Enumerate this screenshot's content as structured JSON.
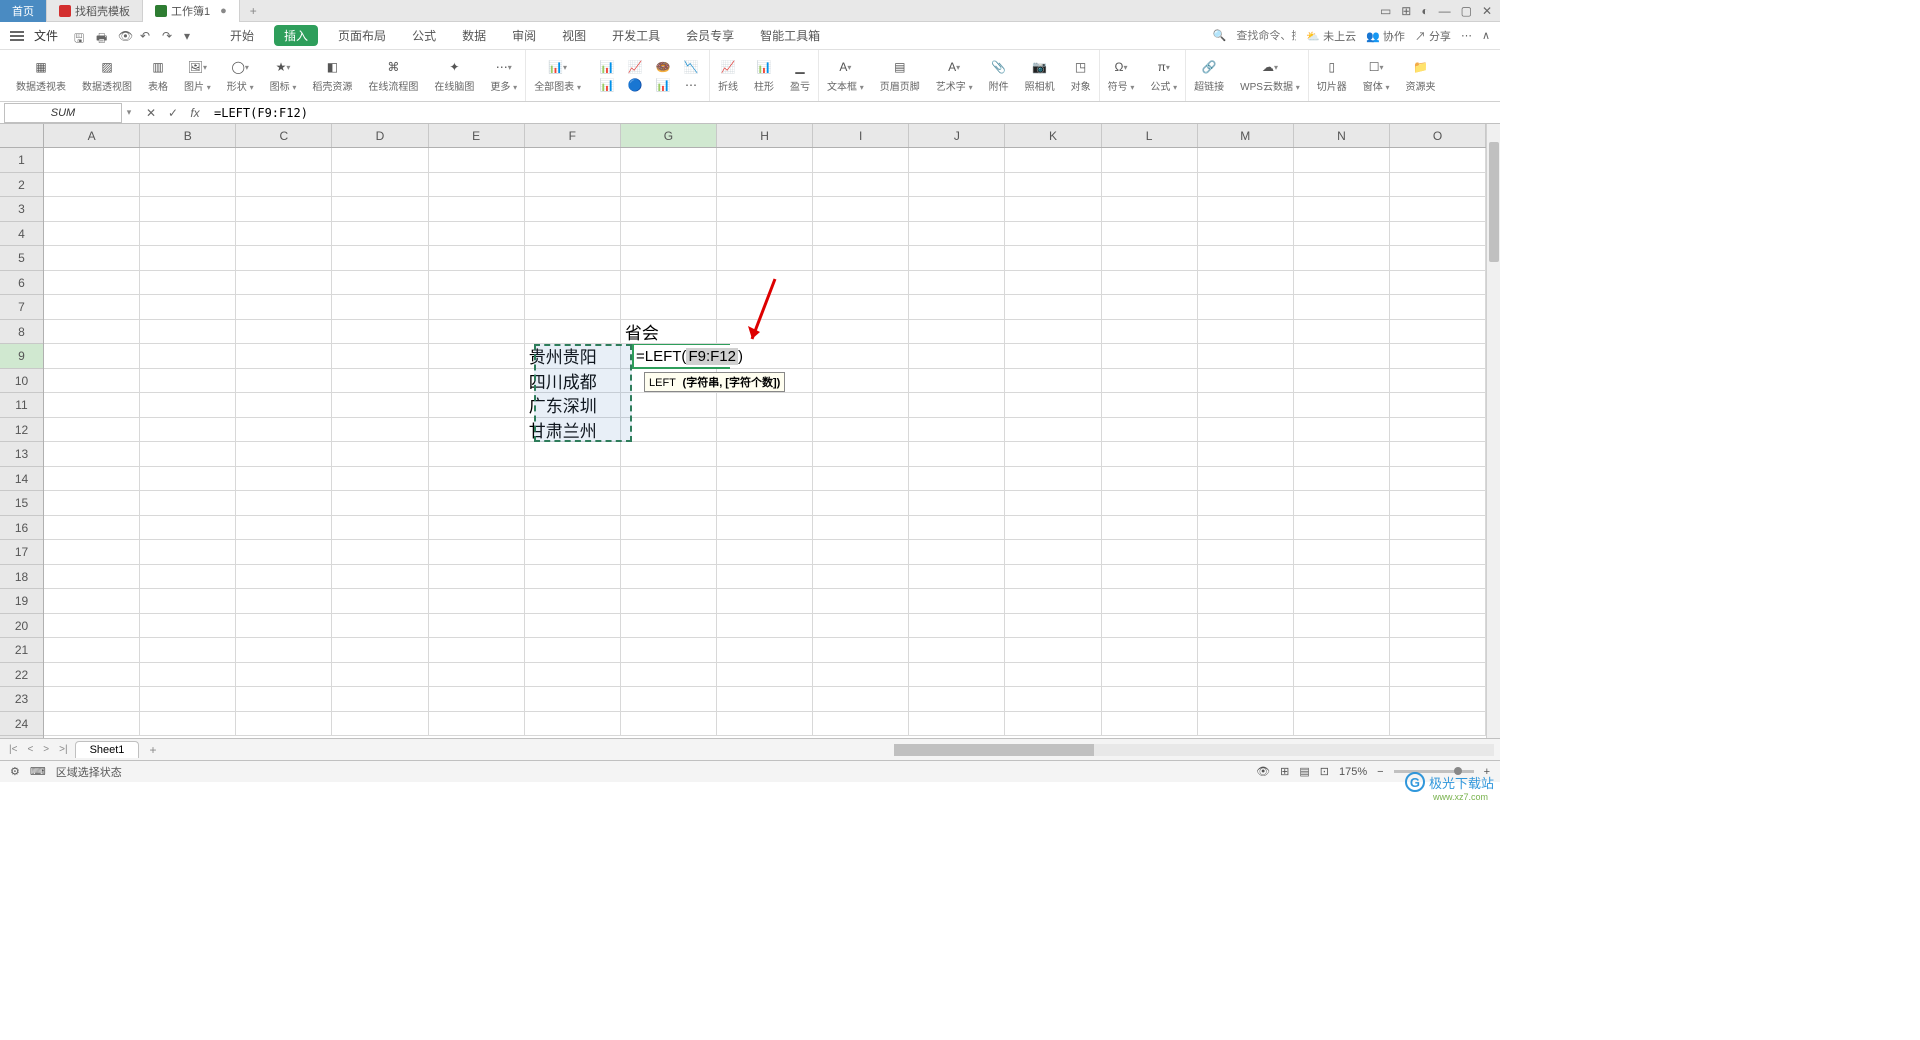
{
  "titlebar": {
    "home": "首页",
    "tab1": "找稻壳模板",
    "tab2": "工作簿1",
    "modified": "●",
    "win_icons": [
      "▭",
      "⊞",
      "◐",
      "—",
      "▢",
      "✕"
    ]
  },
  "menubar": {
    "file": "文件",
    "tabs": [
      "开始",
      "插入",
      "页面布局",
      "公式",
      "数据",
      "审阅",
      "视图",
      "开发工具",
      "会员专享",
      "智能工具箱"
    ],
    "active_tab": 1,
    "search_placeholder": "查找命令、搜索模板",
    "cloud": "未上云",
    "coop": "协作",
    "share": "分享"
  },
  "ribbon": {
    "groups": [
      {
        "label": "数据透视表",
        "icon": "pivot"
      },
      {
        "label": "数据透视图",
        "icon": "pivotchart"
      },
      {
        "label": "表格",
        "icon": "table"
      },
      {
        "label": "图片",
        "icon": "picture",
        "drop": true
      },
      {
        "label": "形状",
        "icon": "shapes",
        "drop": true
      },
      {
        "label": "图标",
        "icon": "icons",
        "drop": true
      },
      {
        "label": "稻壳资源",
        "icon": "resource"
      },
      {
        "label": "在线流程图",
        "icon": "flowchart"
      },
      {
        "label": "在线脑图",
        "icon": "mindmap"
      },
      {
        "label": "更多",
        "icon": "more",
        "drop": true
      },
      {
        "label": "全部图表",
        "icon": "allcharts",
        "drop": true
      },
      {
        "label": "",
        "icon": "chartset",
        "multi": true
      },
      {
        "label": "折线",
        "icon": "line"
      },
      {
        "label": "柱形",
        "icon": "bar"
      },
      {
        "label": "盈亏",
        "icon": "winloss"
      },
      {
        "label": "文本框",
        "icon": "textbox",
        "drop": true
      },
      {
        "label": "页眉页脚",
        "icon": "headerfooter"
      },
      {
        "label": "艺术字",
        "icon": "wordart",
        "drop": true
      },
      {
        "label": "附件",
        "icon": "attach"
      },
      {
        "label": "照相机",
        "icon": "camera"
      },
      {
        "label": "对象",
        "icon": "object"
      },
      {
        "label": "符号",
        "icon": "symbol",
        "drop": true
      },
      {
        "label": "公式",
        "icon": "equation",
        "drop": true
      },
      {
        "label": "超链接",
        "icon": "hyperlink"
      },
      {
        "label": "WPS云数据",
        "icon": "clouddata",
        "drop": true
      },
      {
        "label": "切片器",
        "icon": "slicer"
      },
      {
        "label": "窗体",
        "icon": "form",
        "drop": true
      },
      {
        "label": "资源夹",
        "icon": "folder"
      }
    ]
  },
  "formulabar": {
    "namebox": "SUM",
    "formula": "=LEFT(F9:F12)"
  },
  "sheet": {
    "cols": [
      "A",
      "B",
      "C",
      "D",
      "E",
      "F",
      "G",
      "H",
      "I",
      "J",
      "K",
      "L",
      "M",
      "N",
      "O"
    ],
    "rows": 24,
    "sel_col": "G",
    "sel_row": 9,
    "cells": {
      "G8": "省会",
      "F9": "贵州贵阳",
      "F10": "四川成都",
      "F11": "广东深圳",
      "F12": "甘肃兰州"
    },
    "active_formula_prefix": "=LEFT(",
    "active_formula_arg": "F9:F12",
    "active_formula_suffix": ")",
    "tooltip_fn": "LEFT",
    "tooltip_args": "(字符串, [字符个数])"
  },
  "sheettabs": {
    "sheet1": "Sheet1"
  },
  "statusbar": {
    "mode": "区域选择状态",
    "zoom": "175%"
  },
  "watermark": {
    "text": "极光下载站",
    "url": "www.xz7.com"
  },
  "chart_data": null
}
